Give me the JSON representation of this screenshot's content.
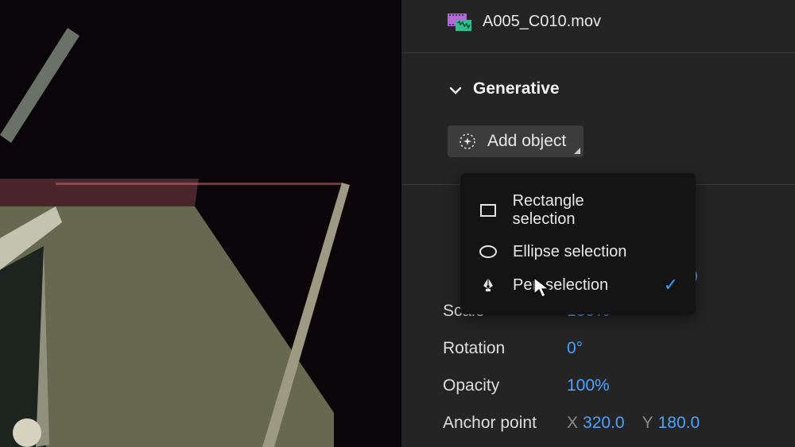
{
  "clip": {
    "filename": "A005_C010.mov"
  },
  "section": {
    "title": "Generative",
    "add_label": "Add object"
  },
  "popover": {
    "items": [
      {
        "label": "Rectangle selection",
        "icon": "rectangle",
        "selected": false
      },
      {
        "label": "Ellipse selection",
        "icon": "ellipse",
        "selected": false
      },
      {
        "label": "Pen selection",
        "icon": "pen",
        "selected": true
      }
    ]
  },
  "peek_value": "0",
  "properties": {
    "scale": {
      "label": "Scale",
      "value": "100%"
    },
    "rotation": {
      "label": "Rotation",
      "value": "0°"
    },
    "opacity": {
      "label": "Opacity",
      "value": "100%"
    },
    "anchor": {
      "label": "Anchor point",
      "x": "320.0",
      "y": "180.0"
    }
  }
}
